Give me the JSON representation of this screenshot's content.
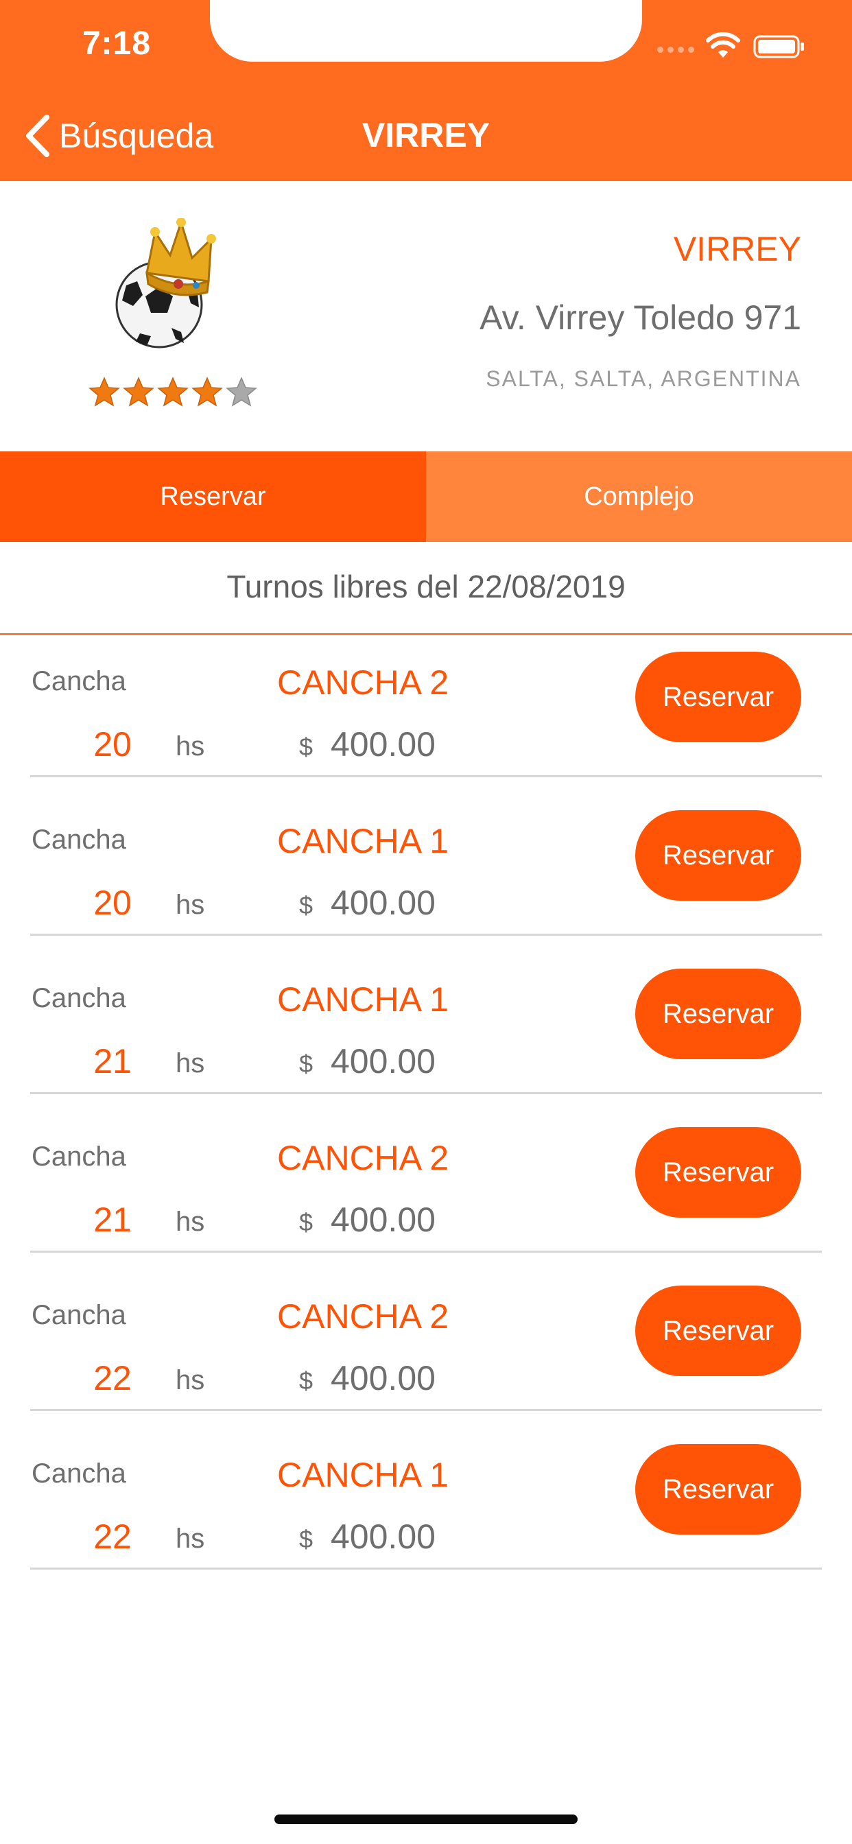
{
  "status_bar": {
    "time": "7:18"
  },
  "nav": {
    "back_label": "Búsqueda",
    "title": "VIRREY"
  },
  "venue": {
    "name": "VIRREY",
    "address": "Av. Virrey Toledo 971",
    "location": "SALTA, SALTA, ARGENTINA",
    "rating": 4,
    "rating_max": 5
  },
  "tabs": [
    {
      "label": "Reservar",
      "active": true
    },
    {
      "label": "Complejo",
      "active": false
    }
  ],
  "list_title": "Turnos libres del 22/08/2019",
  "slots": [
    {
      "label": "Cancha",
      "court": "CANCHA 2",
      "hour": "20",
      "hs": "hs",
      "currency": "$",
      "price": "400.00",
      "button": "Reservar"
    },
    {
      "label": "Cancha",
      "court": "CANCHA 1",
      "hour": "20",
      "hs": "hs",
      "currency": "$",
      "price": "400.00",
      "button": "Reservar"
    },
    {
      "label": "Cancha",
      "court": "CANCHA 1",
      "hour": "21",
      "hs": "hs",
      "currency": "$",
      "price": "400.00",
      "button": "Reservar"
    },
    {
      "label": "Cancha",
      "court": "CANCHA 2",
      "hour": "21",
      "hs": "hs",
      "currency": "$",
      "price": "400.00",
      "button": "Reservar"
    },
    {
      "label": "Cancha",
      "court": "CANCHA 2",
      "hour": "22",
      "hs": "hs",
      "currency": "$",
      "price": "400.00",
      "button": "Reservar"
    },
    {
      "label": "Cancha",
      "court": "CANCHA 1",
      "hour": "22",
      "hs": "hs",
      "currency": "$",
      "price": "400.00",
      "button": "Reservar"
    }
  ],
  "colors": {
    "header": "#ff6c1f",
    "accent": "#ff5406",
    "tab_inactive": "#ff843c",
    "text_gray": "#6e6e6e"
  },
  "icons": {
    "back": "chevron-left-icon",
    "logo": "soccer-ball-crown-icon",
    "star": "star-icon",
    "wifi": "wifi-icon",
    "battery": "battery-icon"
  }
}
